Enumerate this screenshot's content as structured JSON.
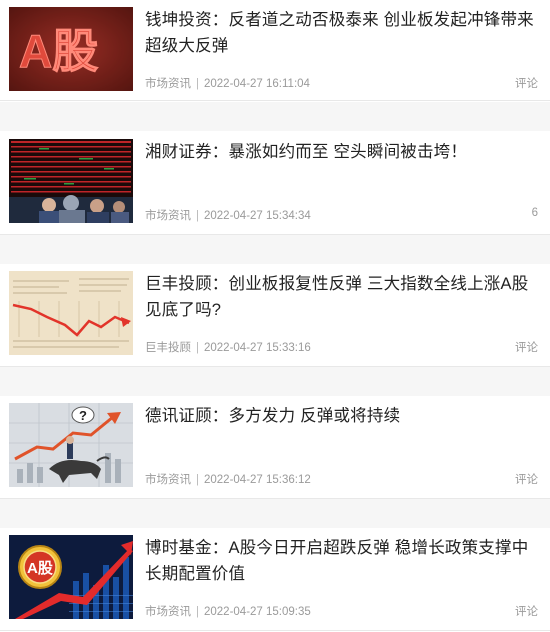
{
  "articles": [
    {
      "title": "钱坤投资：反者道之动否极泰来 创业板发起冲锋带来超级大反弹",
      "source": "市场资讯",
      "time": "2022-04-27 16:11:04",
      "side": "评论",
      "thumb_icon": "a-share-red-text-image",
      "thumb_text": "A股"
    },
    {
      "title": "湘财证券：暴涨如约而至 空头瞬间被击垮！",
      "source": "市场资讯",
      "time": "2022-04-27 15:34:34",
      "side": "6",
      "thumb_icon": "stock-trading-hall-image"
    },
    {
      "title": "巨丰投顾：创业板报复性反弹 三大指数全线上涨A股见底了吗?",
      "source": "巨丰投顾",
      "time": "2022-04-27 15:33:16",
      "side": "评论",
      "thumb_icon": "newspaper-chart-image"
    },
    {
      "title": "德讯证顾：多方发力 反弹或将持续",
      "source": "市场资讯",
      "time": "2022-04-27 15:36:12",
      "side": "评论",
      "thumb_icon": "bull-market-image",
      "thumb_text": "?"
    },
    {
      "title": "博时基金：A股今日开启超跌反弹 稳增长政策支撑中长期配置价值",
      "source": "市场资讯",
      "time": "2022-04-27 15:09:35",
      "side": "评论",
      "thumb_icon": "a-share-coin-chart-image",
      "thumb_text": "A股"
    }
  ],
  "separator": "|"
}
